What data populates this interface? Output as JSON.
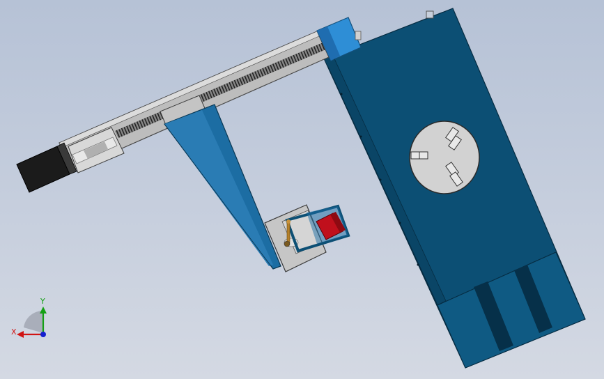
{
  "viewport": {
    "background_top": "#b6c2d6",
    "background_bottom": "#d4d9e3"
  },
  "colors": {
    "body_blue": "#0c4f74",
    "body_blue_light": "#1f6a96",
    "rail_gray": "#bdbdbd",
    "motor_black": "#1b1b1b",
    "coupler_blue": "#2e8ed6",
    "fixture_red": "#c0101c",
    "brass": "#b5802a",
    "turntable_gray": "#cfcfcf"
  },
  "triad": {
    "x_label": "X",
    "y_label": "Y",
    "x_color": "#d01414",
    "y_color": "#14a014",
    "z_color": "#1420d0"
  },
  "icons": {
    "triad": "coordinate-triad-icon"
  }
}
